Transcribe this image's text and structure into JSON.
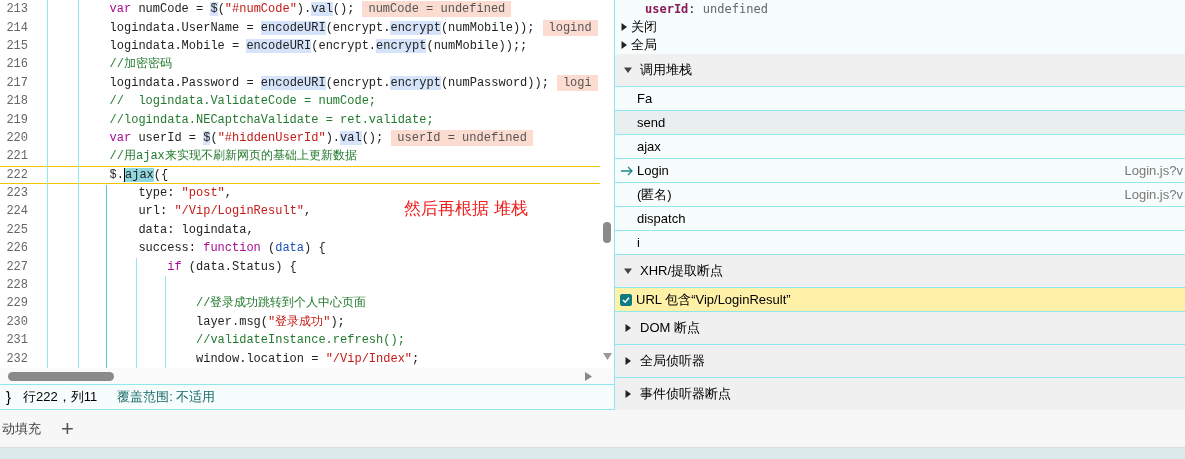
{
  "editor": {
    "lines": [
      {
        "number": "213",
        "current": false,
        "tokens": [
          {
            "kind": "kw",
            "text": "var"
          },
          {
            "kind": "plain",
            "text": " numCode = "
          },
          {
            "kind": "hl",
            "text": "$"
          },
          {
            "kind": "plain",
            "text": "("
          },
          {
            "kind": "str",
            "text": "\"#numCode\""
          },
          {
            "kind": "plain",
            "text": ")."
          },
          {
            "kind": "hl",
            "text": "val"
          },
          {
            "kind": "plain",
            "text": "();"
          }
        ],
        "inline_value": "numCode = undefined"
      },
      {
        "number": "214",
        "current": false,
        "tokens": [
          {
            "kind": "plain",
            "text": "logindata.UserName = "
          },
          {
            "kind": "hl",
            "text": "encodeURI"
          },
          {
            "kind": "plain",
            "text": "(encrypt."
          },
          {
            "kind": "hl",
            "text": "encrypt"
          },
          {
            "kind": "plain",
            "text": "(numMobile));"
          }
        ],
        "inline_value": "logind"
      },
      {
        "number": "215",
        "current": false,
        "tokens": [
          {
            "kind": "plain",
            "text": "logindata.Mobile = "
          },
          {
            "kind": "hl",
            "text": "encodeURI"
          },
          {
            "kind": "plain",
            "text": "(encrypt."
          },
          {
            "kind": "hl",
            "text": "encrypt"
          },
          {
            "kind": "plain",
            "text": "(numMobile));;"
          }
        ]
      },
      {
        "number": "216",
        "current": false,
        "tokens": [
          {
            "kind": "cmt",
            "text": "//加密密码"
          }
        ]
      },
      {
        "number": "217",
        "current": false,
        "tokens": [
          {
            "kind": "plain",
            "text": "logindata.Password = "
          },
          {
            "kind": "hl",
            "text": "encodeURI"
          },
          {
            "kind": "plain",
            "text": "(encrypt."
          },
          {
            "kind": "hl",
            "text": "encrypt"
          },
          {
            "kind": "plain",
            "text": "(numPassword));"
          }
        ],
        "inline_value": "logi"
      },
      {
        "number": "218",
        "current": false,
        "tokens": [
          {
            "kind": "cmt",
            "text": "//  logindata.ValidateCode = numCode;"
          }
        ]
      },
      {
        "number": "219",
        "current": false,
        "tokens": [
          {
            "kind": "cmt",
            "text": "//logindata.NECaptchaValidate = ret.validate;"
          }
        ]
      },
      {
        "number": "220",
        "current": false,
        "tokens": [
          {
            "kind": "kw",
            "text": "var"
          },
          {
            "kind": "plain",
            "text": " userId = "
          },
          {
            "kind": "hl",
            "text": "$"
          },
          {
            "kind": "plain",
            "text": "("
          },
          {
            "kind": "str",
            "text": "\"#hiddenUserId\""
          },
          {
            "kind": "plain",
            "text": ")."
          },
          {
            "kind": "hl",
            "text": "val"
          },
          {
            "kind": "plain",
            "text": "();"
          }
        ],
        "inline_value": "userId = undefined"
      },
      {
        "number": "221",
        "current": false,
        "tokens": [
          {
            "kind": "cmt",
            "text": "//用ajax来实现不刷新网页的基础上更新数据"
          }
        ]
      },
      {
        "number": "222",
        "current": true,
        "tokens": [
          {
            "kind": "plain",
            "text": "$."
          },
          {
            "kind": "sel",
            "text": "ajax"
          },
          {
            "kind": "plain",
            "text": "({"
          }
        ],
        "children": [
          {
            "number": "223",
            "current": false,
            "tokens": [
              {
                "kind": "plain",
                "text": "type: "
              },
              {
                "kind": "str",
                "text": "\"post\""
              },
              {
                "kind": "plain",
                "text": ","
              }
            ]
          },
          {
            "number": "224",
            "current": false,
            "tokens": [
              {
                "kind": "plain",
                "text": "url: "
              },
              {
                "kind": "str",
                "text": "\"/Vip/LoginResult\""
              },
              {
                "kind": "plain",
                "text": ","
              }
            ]
          },
          {
            "number": "225",
            "current": false,
            "tokens": [
              {
                "kind": "plain",
                "text": "data: logindata,"
              }
            ]
          },
          {
            "number": "226",
            "current": false,
            "tokens": [
              {
                "kind": "plain",
                "text": "success: "
              },
              {
                "kind": "kw",
                "text": "function"
              },
              {
                "kind": "plain",
                "text": " ("
              },
              {
                "kind": "param",
                "text": "data"
              },
              {
                "kind": "plain",
                "text": ") {"
              }
            ],
            "children": [
              {
                "number": "227",
                "current": false,
                "tokens": [
                  {
                    "kind": "kw",
                    "text": "if"
                  },
                  {
                    "kind": "plain",
                    "text": " (data.Status) {"
                  }
                ],
                "children": [
                  {
                    "number": "228",
                    "current": false
                  },
                  {
                    "number": "229",
                    "current": false,
                    "tokens": [
                      {
                        "kind": "cmt",
                        "text": "//登录成功跳转到个人中心页面"
                      }
                    ]
                  },
                  {
                    "number": "230",
                    "current": false,
                    "tokens": [
                      {
                        "kind": "plain",
                        "text": "layer.msg("
                      },
                      {
                        "kind": "str",
                        "text": "\"登录成功\""
                      },
                      {
                        "kind": "plain",
                        "text": ");"
                      }
                    ]
                  },
                  {
                    "number": "231",
                    "current": false,
                    "tokens": [
                      {
                        "kind": "cmt",
                        "text": "//validateInstance.refresh();"
                      }
                    ]
                  },
                  {
                    "number": "232",
                    "current": false,
                    "tokens": [
                      {
                        "kind": "plain",
                        "text": "window.location = "
                      },
                      {
                        "kind": "str",
                        "text": "\"/Vip/Index\""
                      },
                      {
                        "kind": "plain",
                        "text": ";"
                      }
                    ]
                  }
                ]
              }
            ]
          }
        ]
      }
    ],
    "annotation_note": "然后再根据 堆栈"
  },
  "status_bar": {
    "brace": "}",
    "position": "行222，列11",
    "coverage": "覆盖范围: 不适用"
  },
  "drawer_tabs": {
    "label": "动填充",
    "add": "+"
  },
  "scope": {
    "variable": {
      "name": "userId",
      "separator": ":",
      "value": "undefined"
    },
    "groups": [
      {
        "label": "关闭",
        "expanded": false
      },
      {
        "label": "全局",
        "expanded": false
      }
    ]
  },
  "sections": [
    {
      "kind": "stack",
      "label": "调用堆栈",
      "expanded": true,
      "frames": [
        {
          "name": "Fa",
          "current": false,
          "selected": false
        },
        {
          "name": "send",
          "current": false,
          "selected": true
        },
        {
          "name": "ajax",
          "current": false,
          "selected": false
        },
        {
          "name": "Login",
          "location": "Login.js?v",
          "current": true,
          "selected": false
        },
        {
          "name": "(匿名)",
          "location": "Login.js?v",
          "current": false,
          "selected": false
        },
        {
          "name": "dispatch",
          "current": false,
          "selected": false
        },
        {
          "name": "i",
          "current": false,
          "selected": false
        }
      ]
    },
    {
      "kind": "xhr",
      "label": "XHR/提取断点",
      "expanded": true,
      "breakpoints": [
        {
          "label": "URL 包含“Vip/LoginResult”",
          "checked": true
        }
      ]
    },
    {
      "kind": "plain",
      "label": "DOM 断点",
      "expanded": false
    },
    {
      "kind": "plain",
      "label": "全局侦听器",
      "expanded": false
    },
    {
      "kind": "plain",
      "label": "事件侦听器断点",
      "expanded": false
    }
  ]
}
